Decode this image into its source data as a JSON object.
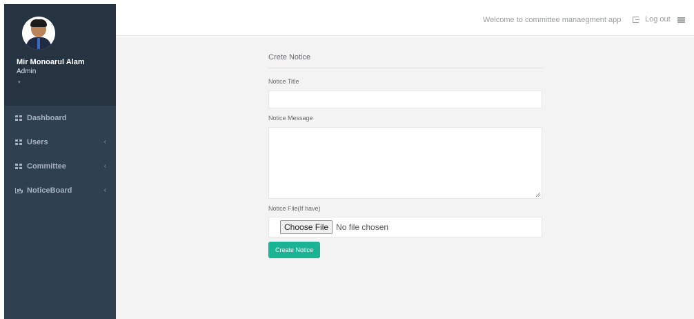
{
  "sidebar": {
    "profile": {
      "name": "Mir Monoarul Alam",
      "role": "Admin",
      "caret": "▾"
    },
    "items": [
      {
        "label": "Dashboard",
        "icon": "grid-icon",
        "chevron": ""
      },
      {
        "label": "Users",
        "icon": "grid-icon",
        "chevron": "‹"
      },
      {
        "label": "Committee",
        "icon": "grid-icon",
        "chevron": "‹"
      },
      {
        "label": "NoticeBoard",
        "icon": "bar-chart-icon",
        "chevron": "‹"
      }
    ]
  },
  "header": {
    "welcome": "Welcome to committee manaegment app",
    "logout_label": "Log out",
    "menu_icon": "menu-icon"
  },
  "form": {
    "title": "Crete Notice",
    "notice_title_label": "Notice Title",
    "notice_title_value": "",
    "notice_message_label": "Notice Message",
    "notice_message_value": "",
    "notice_file_label": "Notice File(If have)",
    "choose_file_label": "Choose File",
    "file_status": "No file chosen",
    "submit_label": "Create Notice"
  },
  "colors": {
    "sidebar_bg": "#2f4050",
    "profile_bg": "#263442",
    "accent": "#1ab394",
    "content_bg": "#f3f3f4"
  }
}
